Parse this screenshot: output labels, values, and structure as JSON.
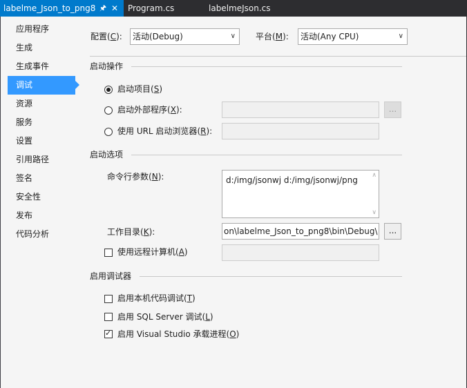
{
  "tabs": [
    {
      "label": "labelme_Json_to_png8",
      "active": true
    },
    {
      "label": "Program.cs",
      "active": false
    },
    {
      "label": "labelmeJson.cs",
      "active": false
    }
  ],
  "tab_icons": {
    "pin": "pin-icon",
    "close": "close-icon"
  },
  "sidebar": {
    "items": [
      {
        "label": "应用程序"
      },
      {
        "label": "生成"
      },
      {
        "label": "生成事件"
      },
      {
        "label": "调试",
        "selected": true
      },
      {
        "label": "资源"
      },
      {
        "label": "服务"
      },
      {
        "label": "设置"
      },
      {
        "label": "引用路径"
      },
      {
        "label": "签名"
      },
      {
        "label": "安全性"
      },
      {
        "label": "发布"
      },
      {
        "label": "代码分析"
      }
    ]
  },
  "config": {
    "config_label": "配置",
    "config_key": "C",
    "config_value": "活动(Debug)",
    "platform_label": "平台",
    "platform_key": "M",
    "platform_value": "活动(Any CPU)"
  },
  "start_action": {
    "title": "启动操作",
    "option1": "启动项目",
    "option1_key": "S",
    "option2": "启动外部程序",
    "option2_key": "X",
    "option3": "使用 URL 启动浏览器",
    "option3_key": "R",
    "browse_label": "..."
  },
  "start_options": {
    "title": "启动选项",
    "args_label": "命令行参数",
    "args_key": "N",
    "args_value": "d:/img/jsonwj d:/img/jsonwj/png",
    "workdir_label": "工作目录",
    "workdir_key": "K",
    "workdir_value": "on\\labelme_Json_to_png8\\bin\\Debug\\",
    "browse_label": "...",
    "remote_label": "使用远程计算机",
    "remote_key": "A"
  },
  "debuggers": {
    "title": "启用调试器",
    "native": "启用本机代码调试",
    "native_key": "T",
    "sql": "启用 SQL Server 调试",
    "sql_key": "L",
    "vshost": "启用 Visual Studio 承载进程",
    "vshost_key": "O"
  },
  "colors": {
    "accent": "#007acc",
    "selection": "#3399ff",
    "background": "#f5f5f5",
    "chrome": "#2d2d30"
  }
}
